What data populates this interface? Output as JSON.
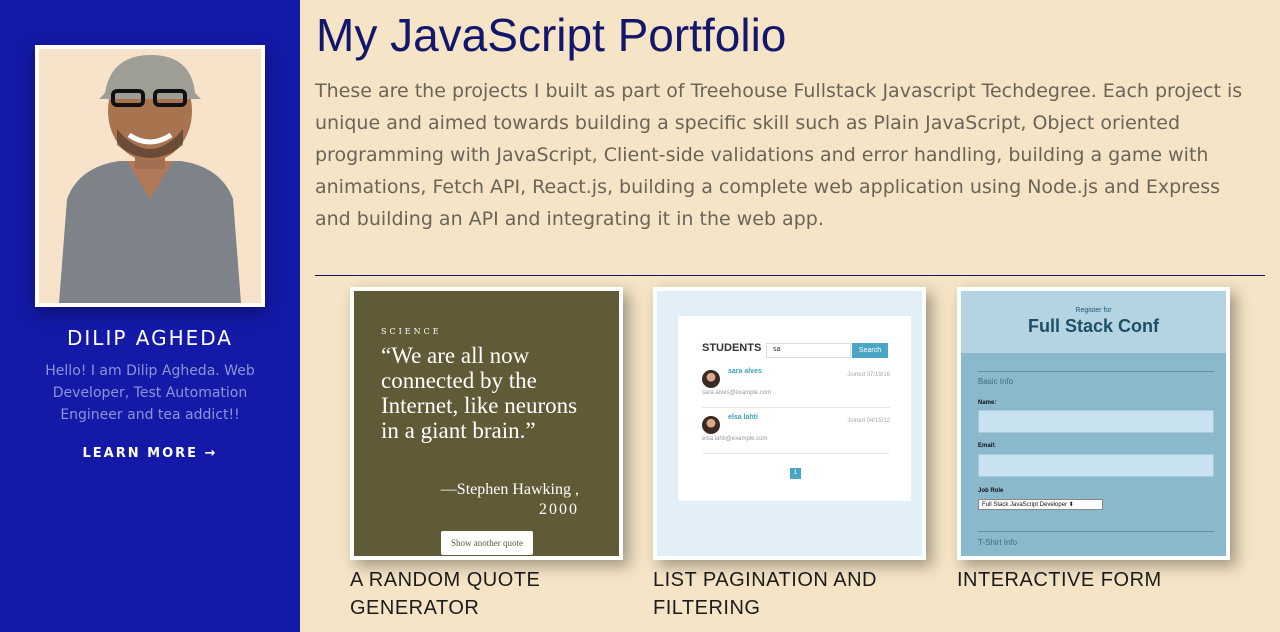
{
  "profile": {
    "name": "DILIP AGHEDA",
    "bio": "Hello! I am Dilip Agheda. Web Developer, Test Automation Engineer and tea addict!!",
    "learn_more": "LEARN MORE →"
  },
  "main": {
    "title": "My JavaScript Portfolio",
    "description": "These are the projects I built as part of Treehouse Fullstack Javascript Techdegree. Each project is unique and aimed towards building a specific skill such as Plain JavaScript, Object oriented programming with JavaScript, Client-side validations and error handling, building a game with animations, Fetch API, React.js, building a complete web application using Node.js and Express and building an API and integrating it in the web app."
  },
  "projects": [
    {
      "title": "A RANDOM QUOTE GENERATOR",
      "preview": {
        "category": "SCIENCE",
        "quote": "“We are all now connected by the Internet, like neurons in a giant brain.”",
        "source": "—Stephen Hawking ,",
        "year": "2000",
        "button": "Show another quote"
      }
    },
    {
      "title": "LIST PAGINATION AND FILTERING",
      "preview": {
        "heading": "STUDENTS",
        "search_value": "sa",
        "search_button": "Search",
        "students": [
          {
            "name": "sara alves",
            "email": "sara.alves@example.com",
            "joined": "Joined 07/19/16"
          },
          {
            "name": "elsa lahti",
            "email": "elsa.lahti@example.com",
            "joined": "Joined 04/15/12"
          }
        ],
        "page": "1"
      }
    },
    {
      "title": "INTERACTIVE FORM",
      "preview": {
        "register_for": "Register for",
        "conf": "Full Stack Conf",
        "basic_info": "Basic Info",
        "name_label": "Name:",
        "email_label": "Email:",
        "job_role_label": "Job Role",
        "job_role_value": "Full Stack JavaScript Developer ⬍",
        "tshirt_info": "T-Shirt Info"
      }
    }
  ],
  "colors": {
    "sidebar": "#1419a8",
    "background": "#f5e4c6",
    "title": "#12176b"
  }
}
